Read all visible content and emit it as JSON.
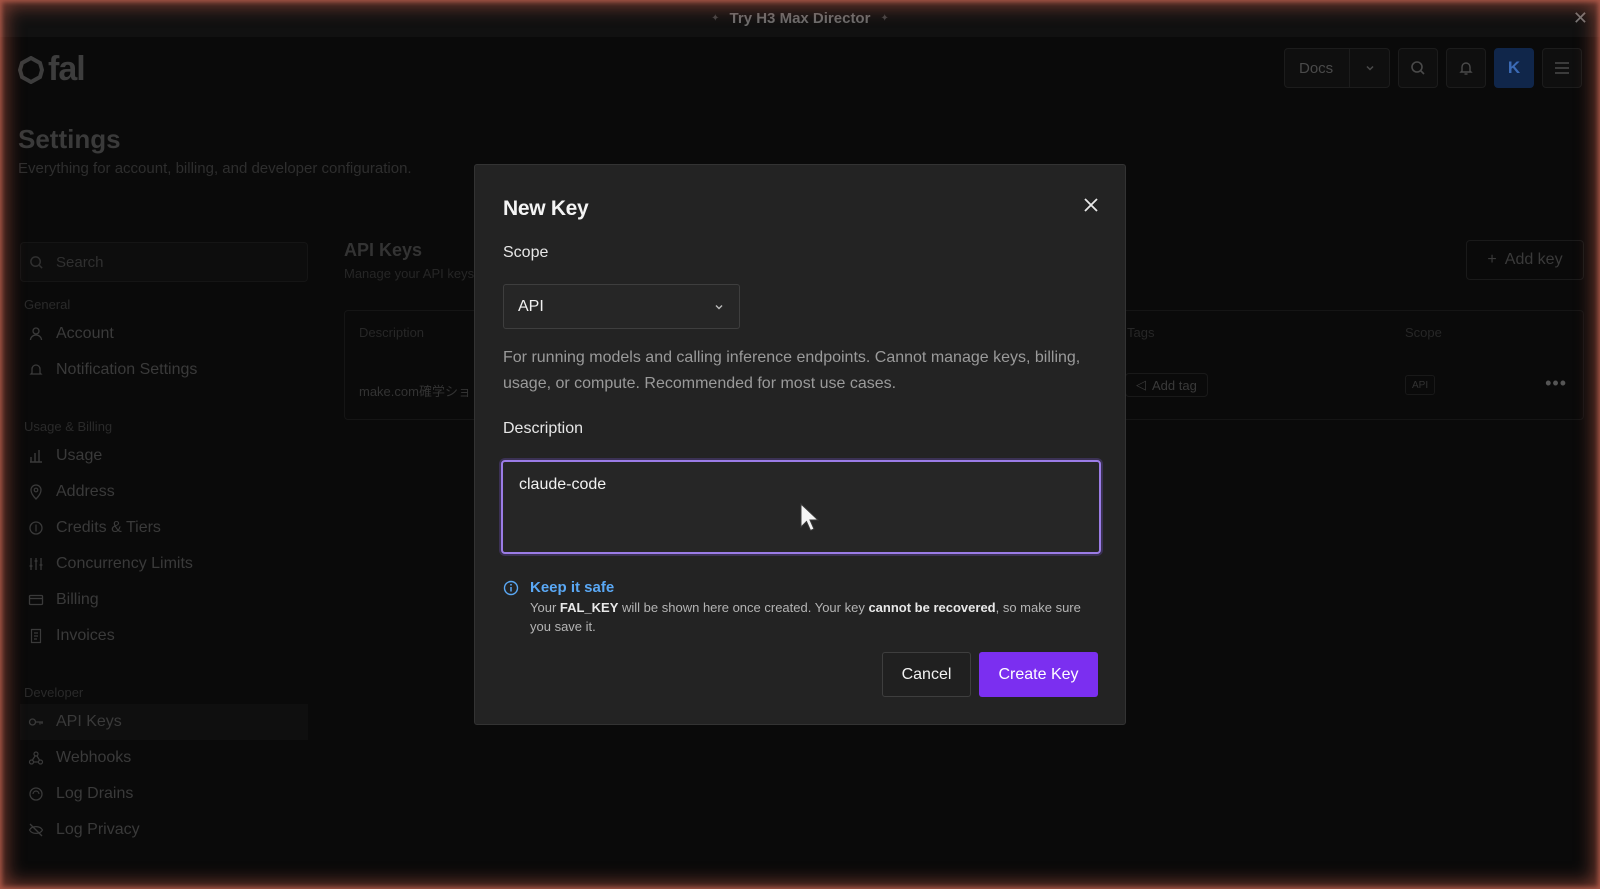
{
  "banner": {
    "text": "Try H3 Max Director"
  },
  "header": {
    "logo_text": "fal",
    "docs_label": "Docs",
    "avatar_initial": "K"
  },
  "page": {
    "title": "Settings",
    "subtitle": "Everything for account, billing, and developer configuration."
  },
  "sidebar": {
    "search_placeholder": "Search",
    "groups": [
      {
        "label": "General",
        "items": [
          {
            "label": "Account",
            "icon": "user-icon"
          },
          {
            "label": "Notification Settings",
            "icon": "bell-icon"
          }
        ]
      },
      {
        "label": "Usage & Billing",
        "items": [
          {
            "label": "Usage",
            "icon": "bar-chart-icon"
          },
          {
            "label": "Address",
            "icon": "map-pin-icon"
          },
          {
            "label": "Credits & Tiers",
            "icon": "coin-icon"
          },
          {
            "label": "Concurrency Limits",
            "icon": "sliders-icon"
          },
          {
            "label": "Billing",
            "icon": "credit-card-icon"
          },
          {
            "label": "Invoices",
            "icon": "receipt-icon"
          }
        ]
      },
      {
        "label": "Developer",
        "items": [
          {
            "label": "API Keys",
            "icon": "key-icon",
            "active": true
          },
          {
            "label": "Webhooks",
            "icon": "webhook-icon"
          },
          {
            "label": "Log Drains",
            "icon": "drain-icon"
          },
          {
            "label": "Log Privacy",
            "icon": "eye-off-icon"
          }
        ]
      }
    ]
  },
  "main": {
    "title": "API Keys",
    "subtitle": "Manage your API keys",
    "add_key_label": "Add key",
    "table": {
      "headers": {
        "description": "Description",
        "tags": "Tags",
        "scope": "Scope"
      },
      "row": {
        "description": "make.com確学ショ",
        "add_tag_label": "Add tag",
        "scope": "API"
      }
    }
  },
  "modal": {
    "title": "New Key",
    "scope_label": "Scope",
    "scope_value": "API",
    "scope_description": "For running models and calling inference endpoints. Cannot manage keys, billing, usage, or compute. Recommended for most use cases.",
    "description_label": "Description",
    "description_value": "claude-code",
    "info_title": "Keep it safe",
    "info_text_1": "Your ",
    "info_text_key": "FAL_KEY",
    "info_text_2": " will be shown here once created. Your key ",
    "info_text_bold": "cannot be recovered",
    "info_text_3": ", so make sure you save it.",
    "cancel_label": "Cancel",
    "create_label": "Create Key"
  },
  "colors": {
    "accent": "#7b2ff0",
    "focus_ring": "#9b7ce6",
    "info": "#5aa8f5",
    "frame_glow": "#c85f4b"
  }
}
